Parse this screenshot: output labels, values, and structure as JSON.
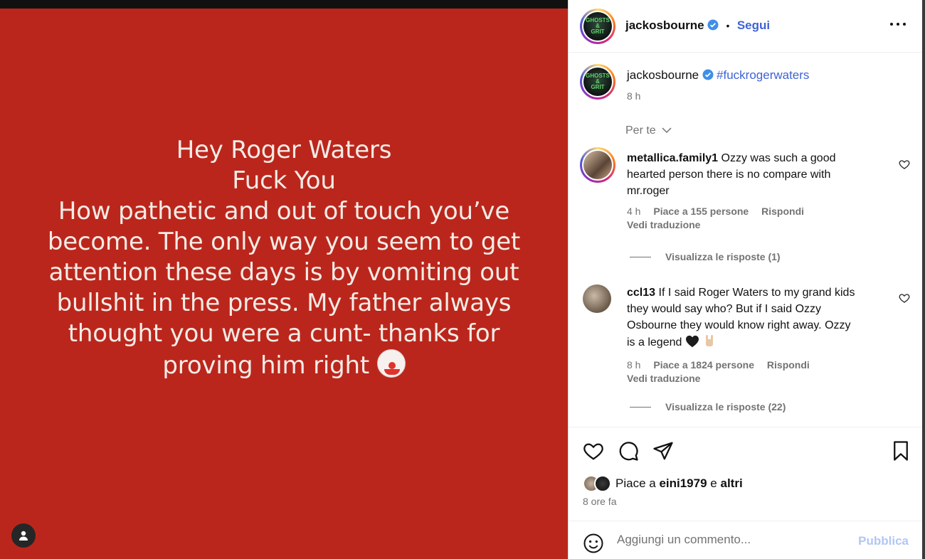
{
  "post": {
    "lines": [
      "Hey Roger Waters",
      "Fuck You",
      "How pathetic and out of touch you’ve",
      "become. The only way you seem to get",
      "attention these days is by vomiting out",
      "bullshit in the press. My father always",
      "thought you were a cunt- thanks for",
      "proving him right"
    ],
    "end_emoji": "clown-face-emoji",
    "background_color": "#bb261c"
  },
  "header": {
    "username": "jackosbourne",
    "follow_label": "Segui",
    "more_icon": "ellipsis-icon"
  },
  "caption": {
    "username": "jackosbourne",
    "hashtag": "#fuckrogerwaters",
    "time": "8 h"
  },
  "filter": {
    "label": "Per te"
  },
  "comments": [
    {
      "username": "metallica.family1",
      "text": "Ozzy was such a good hearted person there is no compare with mr.roger",
      "lines": [
        "Ozzy was such a good",
        "hearted person there is no compare with",
        "mr.roger"
      ],
      "time": "4 h",
      "likes": "Piace a 155 persone",
      "reply": "Rispondi",
      "translate": "Vedi traduzione",
      "view_replies": "Visualizza le risposte (1)"
    },
    {
      "username": "ccl13",
      "lines": [
        "If I said Roger Waters to my grand kids",
        "they would say who? But if I said Ozzy",
        "Osbourne they would know right away. Ozzy",
        "is a legend"
      ],
      "emojis": [
        "black-heart-emoji",
        "sign-of-horns-emoji"
      ],
      "time": "8 h",
      "likes": "Piace a 1824 persone",
      "reply": "Rispondi",
      "translate": "Vedi traduzione",
      "view_replies": "Visualizza le risposte (22)"
    }
  ],
  "likes": {
    "prefix": "Piace a",
    "user": "eini1979",
    "conj": "e",
    "others": "altri",
    "time": "8 ore fa"
  },
  "add_comment": {
    "placeholder": "Aggiungi un commento...",
    "publish": "Pubblica"
  },
  "colors": {
    "accent": "#3f63d6",
    "muted": "#737373",
    "publish_disabled": "#b2c7f5"
  }
}
